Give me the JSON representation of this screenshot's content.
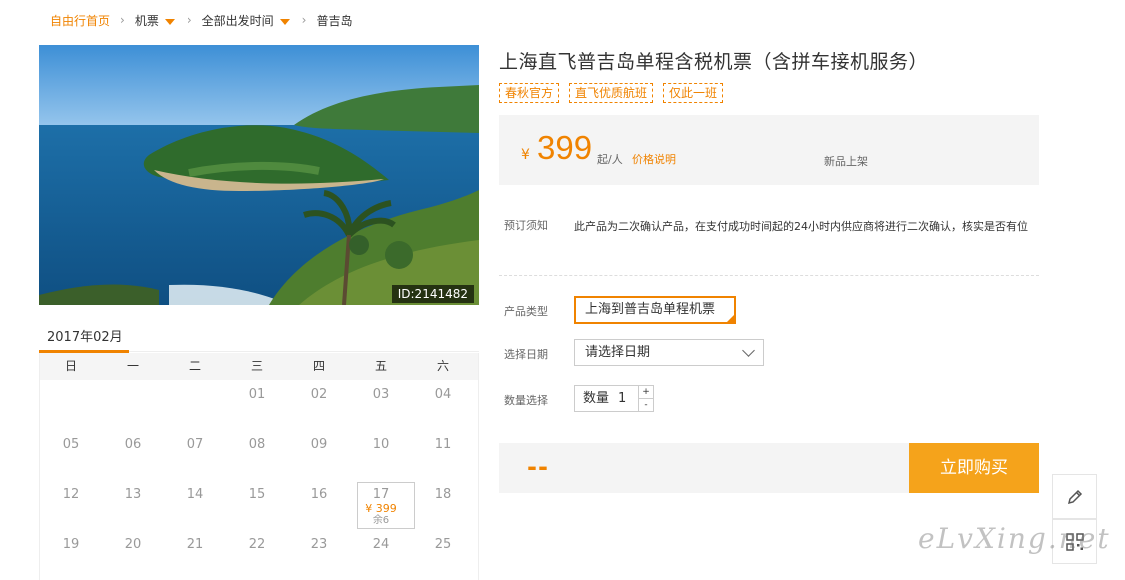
{
  "breadcrumb": {
    "home": "自由行首页",
    "category": "机票",
    "departure": "全部出发时间",
    "destination": "普吉岛"
  },
  "photo": {
    "id_label": "ID:2141482"
  },
  "calendar": {
    "month_label": "2017年02月",
    "weekdays": [
      "日",
      "一",
      "二",
      "三",
      "四",
      "五",
      "六"
    ],
    "weeks": [
      [
        "",
        "",
        "",
        "01",
        "02",
        "03",
        "04"
      ],
      [
        "05",
        "06",
        "07",
        "08",
        "09",
        "10",
        "11"
      ],
      [
        "12",
        "13",
        "14",
        "15",
        "16",
        "17",
        "18"
      ],
      [
        "19",
        "20",
        "21",
        "22",
        "23",
        "24",
        "25"
      ]
    ],
    "available_day": {
      "day": "17",
      "price": "¥ 399",
      "stock": "余6"
    }
  },
  "product": {
    "title": "上海直飞普吉岛单程含税机票（含拼车接机服务）",
    "tags": [
      "春秋官方",
      "直飞优质航班",
      "仅此一班"
    ],
    "price": {
      "currency": "¥",
      "amount": "399",
      "unit": "起/人",
      "explain_link": "价格说明",
      "new_label": "新品上架"
    },
    "notice": {
      "label": "预订须知",
      "text": "此产品为二次确认产品，在支付成功时间起的24小时内供应商将进行二次确认，核实是否有位"
    },
    "type": {
      "label": "产品类型",
      "value": "上海到普吉岛单程机票"
    },
    "date": {
      "label": "选择日期",
      "value": "请选择日期"
    },
    "quantity": {
      "label": "数量选择",
      "field_label": "数量",
      "value": "1",
      "plus": "+",
      "minus": "-"
    },
    "total_placeholder": "--",
    "buy_label": "立即购买"
  },
  "watermark": "eLvXing.net",
  "colors": {
    "accent": "#f08300",
    "buy_button": "#f5a31b",
    "panel_bg": "#f4f4f4"
  },
  "icons": [
    "pencil-icon",
    "qr-code-icon"
  ]
}
